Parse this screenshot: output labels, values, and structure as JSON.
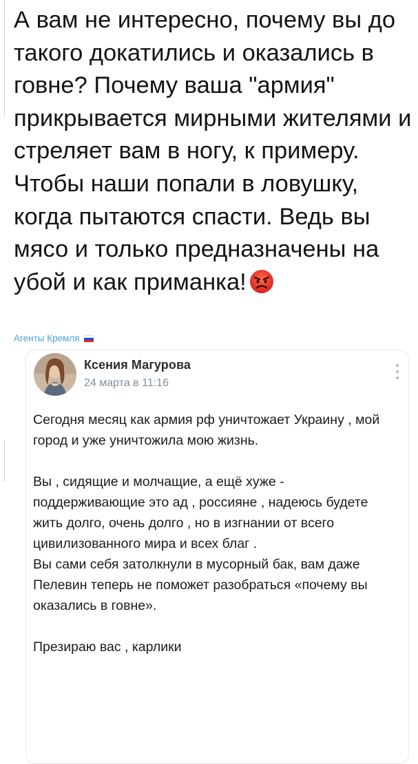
{
  "comment": {
    "text": "А вам не интересно, почему вы до такого докатились и оказались в говне? Почему ваша \"армия\" прикрывается мирными жителями и стреляет вам в ногу, к примеру. Чтобы наши попали в ловушку, когда пытаются спасти. Ведь вы мясо и только предназначены на убой и как приманка!",
    "emoji_icon": "angry-face-icon"
  },
  "source": {
    "label": "Агенты Кремля",
    "flag_colors": [
      "#ffffff",
      "#1c4fd8",
      "#e0262b"
    ]
  },
  "post": {
    "author": "Ксения Магурова",
    "date": "24 марта в 11:16",
    "menu_icon": "more-vertical-icon",
    "paragraphs": [
      "Сегодня месяц как армия рф уничтожает Украину , мой город и уже уничтожила мою жизнь.",
      "Вы , сидящие и молчащие, а ещё хуже - поддерживающие это ад , россияне , надеюсь будете жить долго, очень долго , но в изгнании от всего цивилизованного мира и всех благ .",
      "Вы сами себя затолкнули в мусорный бак, вам даже Пелевин теперь не поможет разобраться «почему вы оказались в говне».",
      "Презираю вас , карлики"
    ]
  }
}
